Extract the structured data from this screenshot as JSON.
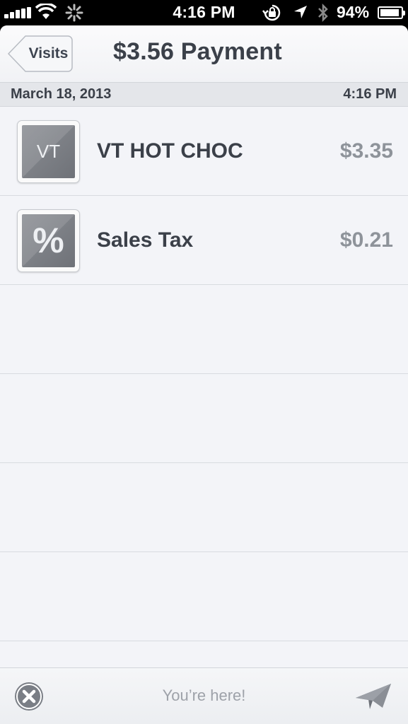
{
  "status_bar": {
    "time": "4:16 PM",
    "battery_text": "94%",
    "battery_level": 0.94,
    "icons": [
      "signal-icon",
      "wifi-icon",
      "activity-spinner-icon",
      "rotation-lock-icon",
      "location-icon",
      "bluetooth-icon",
      "battery-icon"
    ]
  },
  "nav": {
    "back_label": "Visits",
    "title": "$3.56 Payment"
  },
  "date_header": {
    "date": "March 18, 2013",
    "time": "4:16 PM"
  },
  "items": [
    {
      "icon_text": "VT",
      "name": "VT HOT CHOC",
      "price": "$3.35"
    },
    {
      "icon_text": "%",
      "name": "Sales Tax",
      "price": "$0.21"
    }
  ],
  "toolbar": {
    "status_text": "You’re here!",
    "icons": [
      "close-icon",
      "paper-plane-icon"
    ]
  },
  "colors": {
    "title_text": "#3b4049",
    "price_text": "#8e939a",
    "background": "#f3f4f8"
  }
}
